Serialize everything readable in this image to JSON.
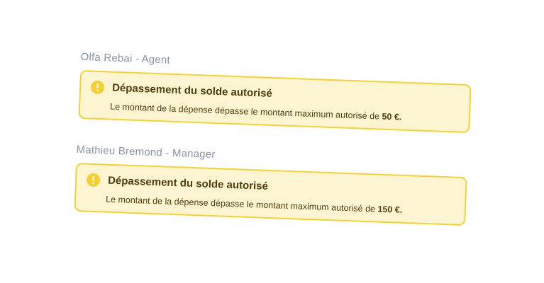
{
  "colors": {
    "alert_background": "#fdf5d2",
    "alert_border": "#f2d23a",
    "warning_icon": "#f4cf35",
    "alert_text": "#4e3d0e",
    "role_label": "#8996a8"
  },
  "approvals": [
    {
      "role_label": "Olfa Rebai - Agent",
      "alert": {
        "icon": "exclamation-circle-icon",
        "title": "Dépassement du solde autorisé",
        "message": "Le montant de la dépense dépasse le montant maximum autorisé de",
        "amount": "50 €."
      }
    },
    {
      "role_label": "Mathieu Bremond - Manager",
      "alert": {
        "icon": "exclamation-circle-icon",
        "title": "Dépassement du solde autorisé",
        "message": "Le montant de la dépense dépasse le montant maximum autorisé de",
        "amount": "150 €."
      }
    }
  ]
}
